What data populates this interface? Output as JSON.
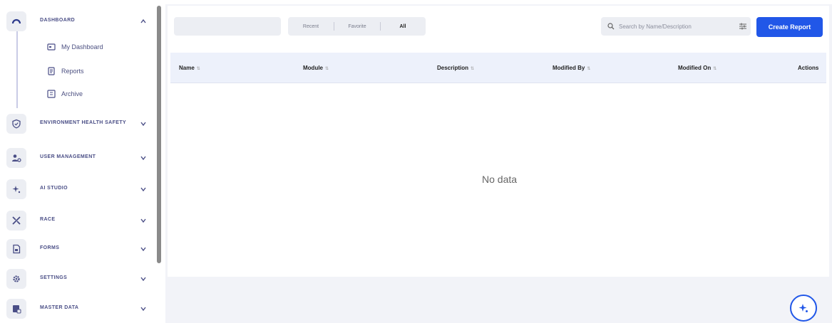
{
  "sidebar": {
    "sections": [
      {
        "label": "DASHBOARD",
        "icon": "gauge-icon",
        "chevron": "up"
      },
      {
        "label": "ENVIRONMENT HEALTH SAFETY",
        "icon": "shield-icon",
        "chevron": "down"
      },
      {
        "label": "USER MANAGEMENT",
        "icon": "user-gear-icon",
        "chevron": "down"
      },
      {
        "label": "AI STUDIO",
        "icon": "sparkle-icon",
        "chevron": "down"
      },
      {
        "label": "RACE",
        "icon": "tools-icon",
        "chevron": "down"
      },
      {
        "label": "FORMS",
        "icon": "form-icon",
        "chevron": "down"
      },
      {
        "label": "SETTINGS",
        "icon": "gear-icon",
        "chevron": "down"
      },
      {
        "label": "MASTER DATA",
        "icon": "database-icon",
        "chevron": "down"
      }
    ],
    "dashboard_items": [
      {
        "label": "My Dashboard",
        "icon": "monitor-icon"
      },
      {
        "label": "Reports",
        "icon": "report-icon"
      },
      {
        "label": "Archive",
        "icon": "archive-icon"
      }
    ]
  },
  "toolbar": {
    "tabs": [
      {
        "label": "Recent",
        "active": false
      },
      {
        "label": "Favorite",
        "active": false
      },
      {
        "label": "All",
        "active": true
      }
    ],
    "search_placeholder": "Search by Name/Description",
    "create_label": "Create Report"
  },
  "table": {
    "columns": [
      "Name",
      "Module",
      "Description",
      "Modified By",
      "Modified On",
      "Actions"
    ],
    "sort_indicator": "⇅",
    "empty_text": "No data"
  },
  "colors": {
    "accent": "#2157e8",
    "sidebar_text": "#4a4e86",
    "header_bg": "#edf1fb"
  }
}
